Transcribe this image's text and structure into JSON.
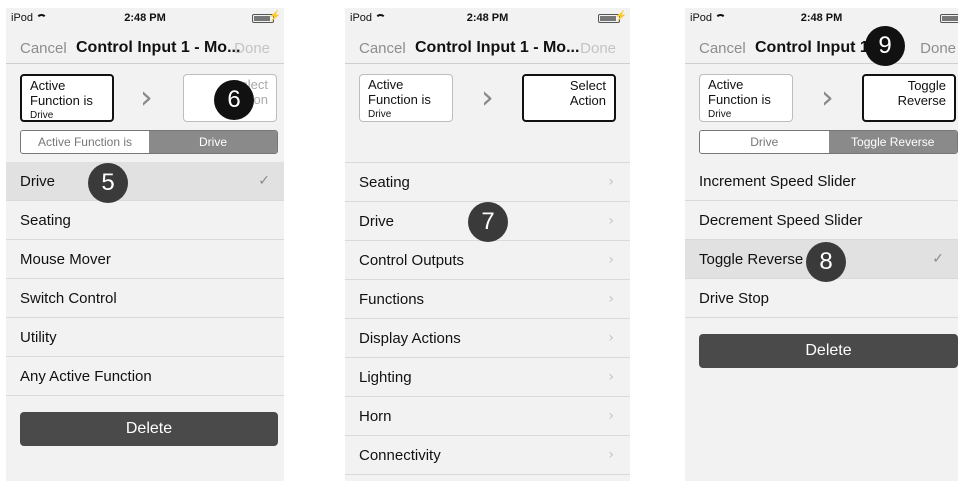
{
  "status": {
    "device": "iPod",
    "time": "2:48 PM"
  },
  "nav": {
    "cancel": "Cancel",
    "title": "Control Input 1 - Mo...",
    "title_short": "Control Input 1 -",
    "done": "Done"
  },
  "screen1": {
    "left_box": {
      "line1": "Active",
      "line2": "Function is",
      "sub": "Drive"
    },
    "right_box": {
      "line1": "Select",
      "line2": "Action"
    },
    "segment": [
      "Active Function is",
      "Drive"
    ],
    "items": [
      {
        "label": "Drive",
        "state": "checked"
      },
      {
        "label": "Seating"
      },
      {
        "label": "Mouse Mover"
      },
      {
        "label": "Switch Control"
      },
      {
        "label": "Utility"
      },
      {
        "label": "Any Active Function"
      }
    ],
    "delete": "Delete",
    "markers": [
      "5",
      "6"
    ]
  },
  "screen2": {
    "left_box": {
      "line1": "Active",
      "line2": "Function is",
      "sub": "Drive"
    },
    "right_box": {
      "line1": "Select",
      "line2": "Action"
    },
    "items": [
      {
        "label": "Seating"
      },
      {
        "label": "Drive"
      },
      {
        "label": "Control Outputs"
      },
      {
        "label": "Functions"
      },
      {
        "label": "Display Actions"
      },
      {
        "label": "Lighting"
      },
      {
        "label": "Horn"
      },
      {
        "label": "Connectivity"
      }
    ],
    "markers": [
      "7"
    ]
  },
  "screen3": {
    "left_box": {
      "line1": "Active",
      "line2": "Function is",
      "sub": "Drive"
    },
    "right_box": {
      "line1": "Toggle",
      "line2": "Reverse"
    },
    "segment": [
      "Drive",
      "Toggle Reverse"
    ],
    "items": [
      {
        "label": "Increment Speed Slider"
      },
      {
        "label": "Decrement Speed Slider"
      },
      {
        "label": "Toggle Reverse",
        "state": "checked"
      },
      {
        "label": "Drive Stop"
      }
    ],
    "delete": "Delete",
    "markers": [
      "8",
      "9"
    ]
  },
  "icons": {
    "chevron": "chevron-right-icon",
    "check": "checkmark-icon",
    "wifi": "wifi-icon",
    "battery": "battery-icon"
  }
}
